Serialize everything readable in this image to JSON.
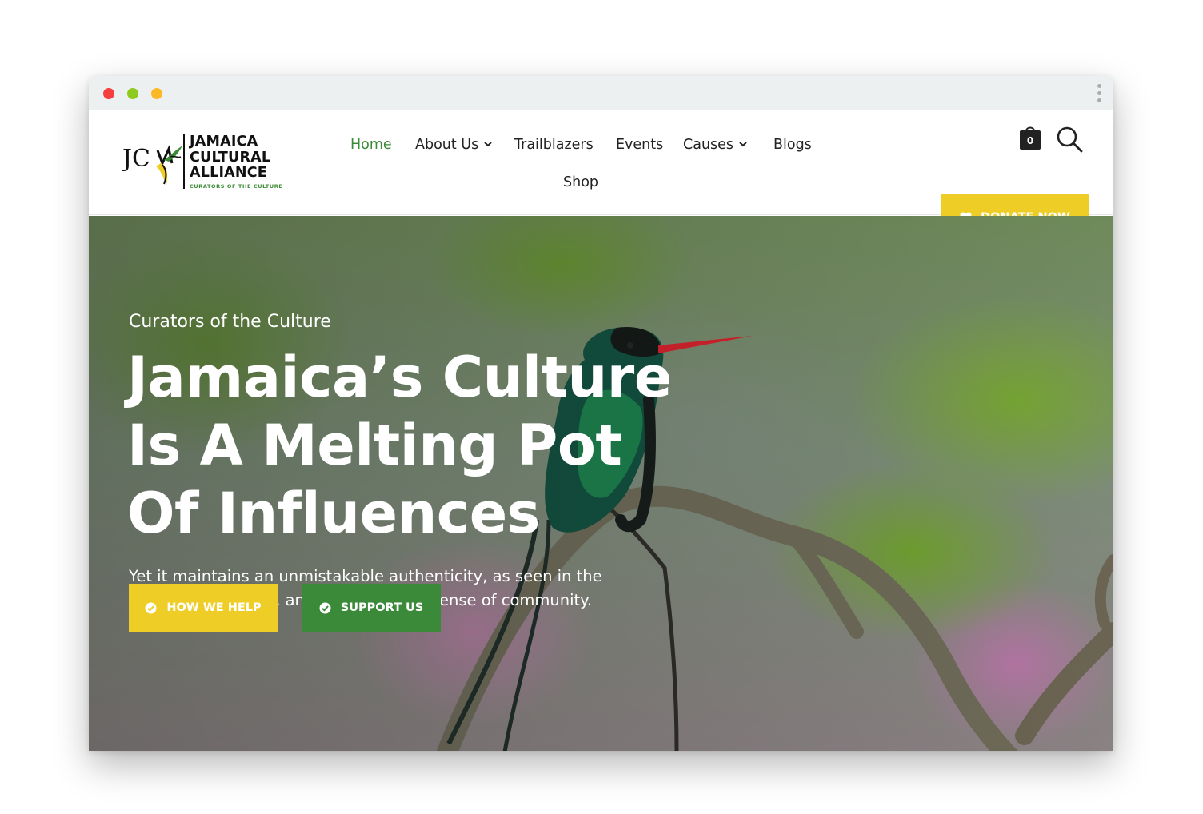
{
  "window": {
    "title_dots": [
      "red",
      "green",
      "yellow"
    ]
  },
  "brand": {
    "logo_line1": "JAMAICA",
    "logo_line2": "CULTURAL",
    "logo_line3": "ALLIANCE",
    "logo_tagline": "CURATORS OF THE CULTURE",
    "logo_monogram": "JCA"
  },
  "nav": {
    "items": [
      {
        "label": "Home",
        "active": true
      },
      {
        "label": "About Us",
        "has_dropdown": true
      },
      {
        "label": "Trailblazers"
      },
      {
        "label": "Events"
      },
      {
        "label": "Causes",
        "has_dropdown": true
      },
      {
        "label": "Blogs"
      },
      {
        "label": "Shop"
      }
    ]
  },
  "header_actions": {
    "cart_count": "0",
    "cart_icon": "shopping-bag-icon",
    "search_icon": "search-icon",
    "donate_label": "DONATE NOW",
    "donate_icon": "heart-icon"
  },
  "hero": {
    "eyebrow": "Curators of the Culture",
    "headline_lines": [
      "Jamaica’s Culture",
      "Is A Melting Pot",
      "Of Influences"
    ],
    "description_lines": [
      "Yet it maintains an unmistakable authenticity, as seen in the",
      "infectious laughter, and the pervasive sense of community."
    ],
    "buttons": [
      {
        "label": "HOW WE HELP",
        "icon": "check-circle-icon"
      },
      {
        "label": "SUPPORT US",
        "icon": "check-circle-icon"
      }
    ]
  },
  "colors": {
    "accent_yellow": "#efcd27",
    "accent_green": "#3b8a3a",
    "nav_active": "#3b8a35",
    "titlebar": "#edf0f0"
  }
}
